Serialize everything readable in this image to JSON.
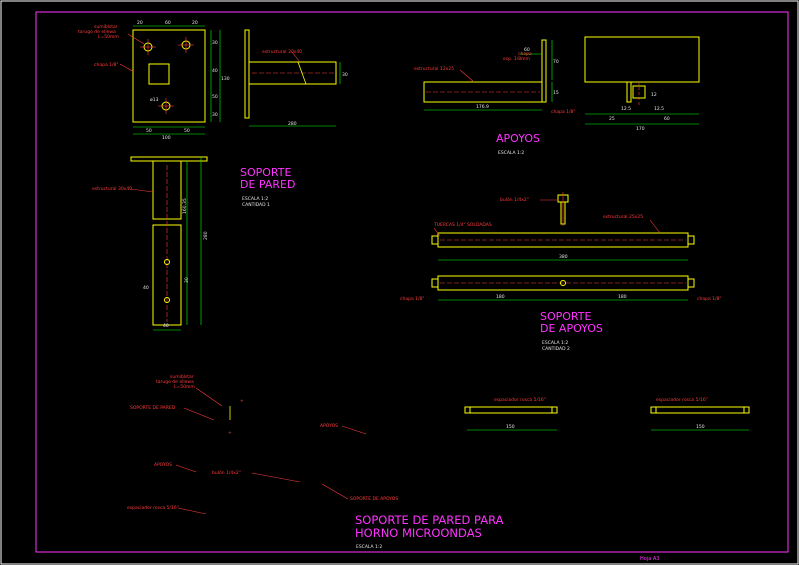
{
  "colors": {
    "background": "#000000",
    "frame": "#ff33ff",
    "geometry": "#ffff00",
    "dimension": "#00ff00",
    "annotation": "#ff3b3b",
    "text_white": "#e6e6e6",
    "title": "#ff33ff",
    "cyan": "#00ffff"
  },
  "wall_bracket": {
    "title_line1": "SOPORTE",
    "title_line2": "DE PARED",
    "scale": "ESCALA 1:2",
    "quantity": "CANTIDAD 1",
    "label_screw": "sumiblstar",
    "label_screw2": "tarugo de ellewa",
    "label_screw3": "L=50mm",
    "label_plate": "chapa 1/8\"",
    "label_profile": "estructural 30x40",
    "label_profile_side": "estructural 30x40",
    "dims": {
      "top_a": "20",
      "top_b": "60",
      "top_c": "20",
      "right_a": "30",
      "right_b": "40",
      "right_c": "50",
      "right_d": "30",
      "overall_h": "130",
      "bottom_a": "50",
      "bottom_b": "50",
      "overall_w": "100",
      "side_w": "280",
      "side_h": "30",
      "hole": "ø13",
      "front_a": "160.35",
      "front_b": "280",
      "front_c": "30",
      "front_w": "40",
      "front_d": "40"
    }
  },
  "supports_detail": {
    "title": "APOYOS",
    "scale": "ESCALA 1:2",
    "label_profile": "estructural 12x25",
    "label_plate": "chapa",
    "label_plate2": "esp. 1/8mm",
    "label_plate_side": "chapa 1/8\"",
    "dims": {
      "a": "60",
      "b": "70",
      "c": "176.9",
      "d": "15",
      "e": "12.5",
      "f": "12.5",
      "g": "25",
      "h": "60",
      "total": "170",
      "small": "12"
    }
  },
  "support_bars": {
    "title_line1": "SOPORTE",
    "title_line2": "DE APOYOS",
    "scale": "ESCALA 1:2",
    "quantity": "CANTIDAD 2",
    "label_bolt": "bulón 1/4x2\"",
    "label_nut": "TUERCAS 1/4\" SOLDADAS",
    "label_profile": "estructural 25x25",
    "label_plate_left": "chapa 1/8\"",
    "label_plate_right": "chapa 1/8\"",
    "dims": {
      "length": "380",
      "half_left": "180",
      "half_right": "180"
    }
  },
  "spacers": {
    "label_left": "espaciador rosca 5/16\"",
    "label_right": "espaciador rosca 5/16\"",
    "dim_left": "150",
    "dim_right": "150"
  },
  "assembly": {
    "label_screw": "sumiblstar",
    "label_screw2": "tarugo de ellewa",
    "label_screw3": "L=50mm",
    "label_wall": "SOPORTE DE PARED",
    "label_supports": "APOYOS",
    "label_supports2": "APOYOS",
    "label_bolt": "bulón 1/4x2\"",
    "label_support_bars": "SOPORTE DE APOYOS",
    "label_spacer": "espaciador rosca 5/16\""
  },
  "title_block": {
    "line1": "SOPORTE DE PARED PARA",
    "line2": "HORNO MICROONDAS",
    "scale": "ESCALA 1:2",
    "sheet": "Hoja A3"
  }
}
